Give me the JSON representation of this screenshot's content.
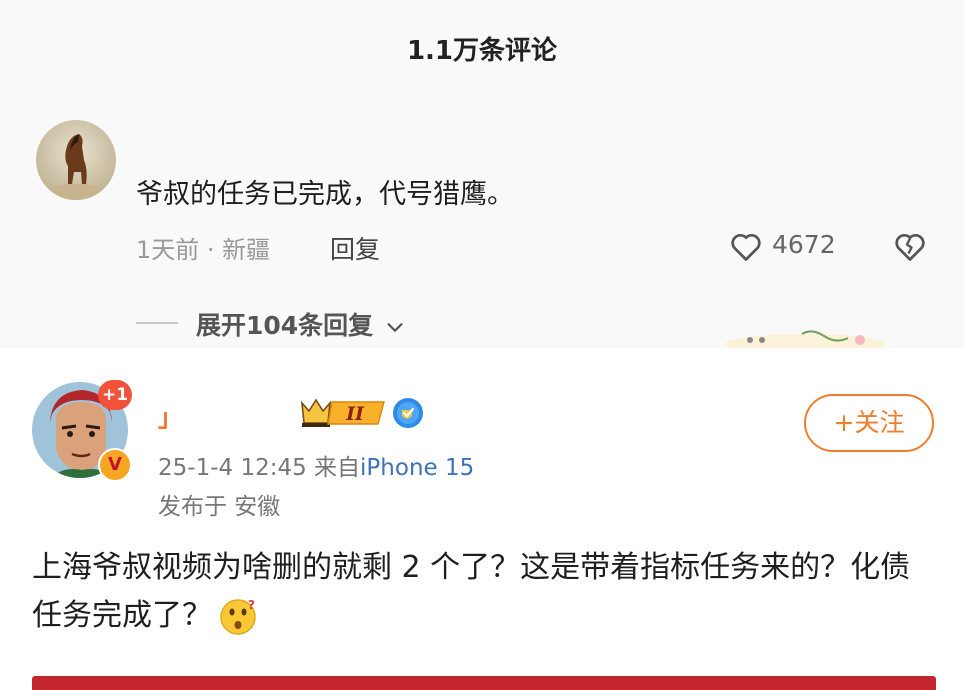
{
  "comments_header": {
    "title": "1.1万条评论"
  },
  "top_comment": {
    "text": "爷叔的任务已完成，代号猎鹰。",
    "meta": "1天前 · 新疆",
    "reply_label": "回复",
    "like_count": "4672",
    "expand_label": "展开104条回复"
  },
  "post": {
    "avatar_badge": "+1",
    "vip_badge": "V",
    "username": "」",
    "rank_badge": "II",
    "time": "25-1-4 12:45",
    "from_label": "来自",
    "device": "iPhone 15",
    "location": "发布于 安徽",
    "follow_label": "+关注",
    "body_text": "上海爷叔视频为啥删的就剩 2 个了？这是带着指标任务来的？化债任务完成了？"
  },
  "colors": {
    "accent_orange": "#f07d2c",
    "link_blue": "#3f72b8",
    "red_bar": "#c4262e"
  },
  "icons": [
    "horse-avatar",
    "heart-icon",
    "broken-heart-icon",
    "chevron-down-icon",
    "crown-badge-icon",
    "verified-badge-icon",
    "thinking-face-emoji"
  ]
}
